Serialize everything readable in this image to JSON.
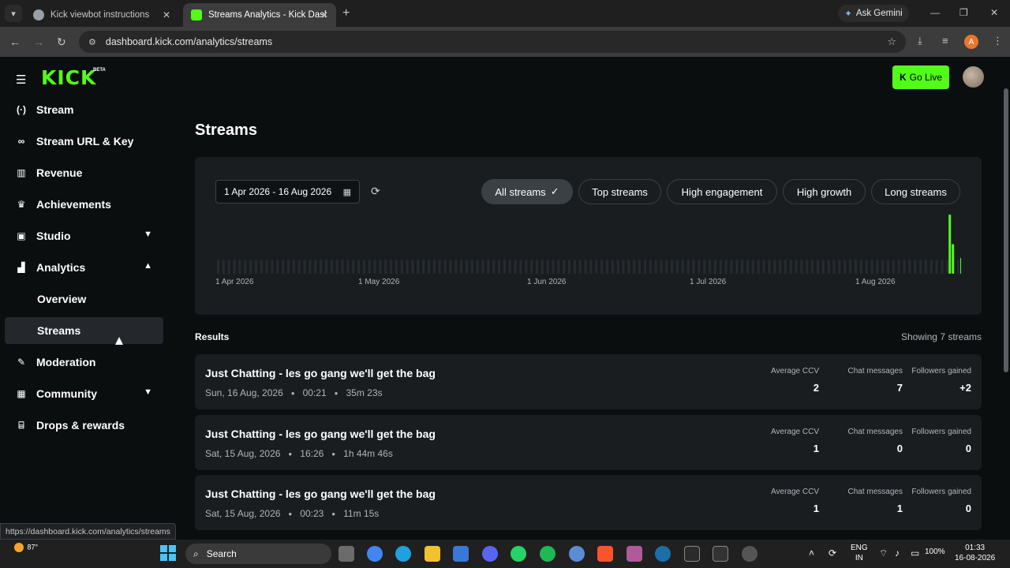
{
  "browser": {
    "tabs": [
      {
        "title": "Kick viewbot instructions",
        "favicon_color": "#9aa0a6",
        "active": false
      },
      {
        "title": "Streams Analytics - Kick Dashbo",
        "favicon_color": "#53fc18",
        "active": true
      }
    ],
    "ask_gemini": "Ask Gemini",
    "url": "dashboard.kick.com/analytics/streams",
    "profile_initial": "A",
    "status_url": "https://dashboard.kick.com/analytics/streams"
  },
  "header": {
    "logo": "KICK",
    "beta": "BETA",
    "go_live": "Go Live"
  },
  "sidebar": {
    "items": [
      {
        "label": "Stream",
        "icon": "stream-icon"
      },
      {
        "label": "Stream URL & Key",
        "icon": "link-icon"
      },
      {
        "label": "Revenue",
        "icon": "revenue-icon"
      },
      {
        "label": "Achievements",
        "icon": "trophy-icon"
      },
      {
        "label": "Studio",
        "icon": "studio-icon",
        "chevron": "down"
      },
      {
        "label": "Analytics",
        "icon": "analytics-icon",
        "chevron": "up"
      },
      {
        "label": "Overview",
        "sub": true
      },
      {
        "label": "Streams",
        "sub": true,
        "selected": true
      },
      {
        "label": "Moderation",
        "icon": "wrench-icon"
      },
      {
        "label": "Community",
        "icon": "community-icon",
        "chevron": "down"
      },
      {
        "label": "Drops & rewards",
        "icon": "gift-icon"
      }
    ]
  },
  "main": {
    "title": "Streams",
    "date_range": "1 Apr 2026 - 16 Aug 2026",
    "filters": [
      "All streams",
      "Top streams",
      "High engagement",
      "High growth",
      "Long streams"
    ],
    "active_filter": "All streams",
    "results_heading": "Results",
    "showing": "Showing 7 streams",
    "stat_labels": {
      "ccv": "Average CCV",
      "chat": "Chat messages",
      "followers": "Followers gained"
    },
    "streams": [
      {
        "title": "Just Chatting - les go gang we'll get the bag",
        "date": "Sun, 16 Aug, 2026",
        "time": "00:21",
        "duration": "35m 23s",
        "ccv": "2",
        "chat": "7",
        "followers": "+2"
      },
      {
        "title": "Just Chatting - les go gang we'll get the bag",
        "date": "Sat, 15 Aug, 2026",
        "time": "16:26",
        "duration": "1h 44m 46s",
        "ccv": "1",
        "chat": "0",
        "followers": "0"
      },
      {
        "title": "Just Chatting - les go gang we'll get the bag",
        "date": "Sat, 15 Aug, 2026",
        "time": "00:23",
        "duration": "11m 15s",
        "ccv": "1",
        "chat": "1",
        "followers": "0"
      }
    ]
  },
  "chart_data": {
    "type": "bar",
    "x_tick_labels": [
      "1 Apr 2026",
      "1 May 2026",
      "1 Jun 2026",
      "1 Jul 2026",
      "1 Aug 2026"
    ],
    "bar_color": "#53fc18",
    "empty_bar_color": "#262b2f",
    "active_bars": [
      {
        "date": "2026-08-15",
        "value": 1.0
      },
      {
        "date": "2026-08-15",
        "value": 0.5
      },
      {
        "date": "2026-08-16",
        "value": 0.27
      }
    ]
  },
  "taskbar": {
    "weather": "87°",
    "search": "Search",
    "lang1": "ENG",
    "lang2": "IN",
    "battery": "100%",
    "time": "01:33",
    "date": "16-08-2026"
  }
}
